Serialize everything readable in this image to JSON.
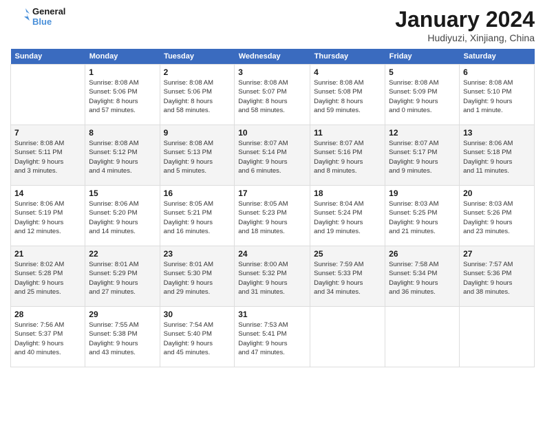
{
  "header": {
    "logo_general": "General",
    "logo_blue": "Blue",
    "month_title": "January 2024",
    "location": "Hudiyuzi, Xinjiang, China"
  },
  "days_of_week": [
    "Sunday",
    "Monday",
    "Tuesday",
    "Wednesday",
    "Thursday",
    "Friday",
    "Saturday"
  ],
  "weeks": [
    [
      {
        "num": "",
        "info": ""
      },
      {
        "num": "1",
        "info": "Sunrise: 8:08 AM\nSunset: 5:06 PM\nDaylight: 8 hours\nand 57 minutes."
      },
      {
        "num": "2",
        "info": "Sunrise: 8:08 AM\nSunset: 5:06 PM\nDaylight: 8 hours\nand 58 minutes."
      },
      {
        "num": "3",
        "info": "Sunrise: 8:08 AM\nSunset: 5:07 PM\nDaylight: 8 hours\nand 58 minutes."
      },
      {
        "num": "4",
        "info": "Sunrise: 8:08 AM\nSunset: 5:08 PM\nDaylight: 8 hours\nand 59 minutes."
      },
      {
        "num": "5",
        "info": "Sunrise: 8:08 AM\nSunset: 5:09 PM\nDaylight: 9 hours\nand 0 minutes."
      },
      {
        "num": "6",
        "info": "Sunrise: 8:08 AM\nSunset: 5:10 PM\nDaylight: 9 hours\nand 1 minute."
      }
    ],
    [
      {
        "num": "7",
        "info": "Sunrise: 8:08 AM\nSunset: 5:11 PM\nDaylight: 9 hours\nand 3 minutes."
      },
      {
        "num": "8",
        "info": "Sunrise: 8:08 AM\nSunset: 5:12 PM\nDaylight: 9 hours\nand 4 minutes."
      },
      {
        "num": "9",
        "info": "Sunrise: 8:08 AM\nSunset: 5:13 PM\nDaylight: 9 hours\nand 5 minutes."
      },
      {
        "num": "10",
        "info": "Sunrise: 8:07 AM\nSunset: 5:14 PM\nDaylight: 9 hours\nand 6 minutes."
      },
      {
        "num": "11",
        "info": "Sunrise: 8:07 AM\nSunset: 5:16 PM\nDaylight: 9 hours\nand 8 minutes."
      },
      {
        "num": "12",
        "info": "Sunrise: 8:07 AM\nSunset: 5:17 PM\nDaylight: 9 hours\nand 9 minutes."
      },
      {
        "num": "13",
        "info": "Sunrise: 8:06 AM\nSunset: 5:18 PM\nDaylight: 9 hours\nand 11 minutes."
      }
    ],
    [
      {
        "num": "14",
        "info": "Sunrise: 8:06 AM\nSunset: 5:19 PM\nDaylight: 9 hours\nand 12 minutes."
      },
      {
        "num": "15",
        "info": "Sunrise: 8:06 AM\nSunset: 5:20 PM\nDaylight: 9 hours\nand 14 minutes."
      },
      {
        "num": "16",
        "info": "Sunrise: 8:05 AM\nSunset: 5:21 PM\nDaylight: 9 hours\nand 16 minutes."
      },
      {
        "num": "17",
        "info": "Sunrise: 8:05 AM\nSunset: 5:23 PM\nDaylight: 9 hours\nand 18 minutes."
      },
      {
        "num": "18",
        "info": "Sunrise: 8:04 AM\nSunset: 5:24 PM\nDaylight: 9 hours\nand 19 minutes."
      },
      {
        "num": "19",
        "info": "Sunrise: 8:03 AM\nSunset: 5:25 PM\nDaylight: 9 hours\nand 21 minutes."
      },
      {
        "num": "20",
        "info": "Sunrise: 8:03 AM\nSunset: 5:26 PM\nDaylight: 9 hours\nand 23 minutes."
      }
    ],
    [
      {
        "num": "21",
        "info": "Sunrise: 8:02 AM\nSunset: 5:28 PM\nDaylight: 9 hours\nand 25 minutes."
      },
      {
        "num": "22",
        "info": "Sunrise: 8:01 AM\nSunset: 5:29 PM\nDaylight: 9 hours\nand 27 minutes."
      },
      {
        "num": "23",
        "info": "Sunrise: 8:01 AM\nSunset: 5:30 PM\nDaylight: 9 hours\nand 29 minutes."
      },
      {
        "num": "24",
        "info": "Sunrise: 8:00 AM\nSunset: 5:32 PM\nDaylight: 9 hours\nand 31 minutes."
      },
      {
        "num": "25",
        "info": "Sunrise: 7:59 AM\nSunset: 5:33 PM\nDaylight: 9 hours\nand 34 minutes."
      },
      {
        "num": "26",
        "info": "Sunrise: 7:58 AM\nSunset: 5:34 PM\nDaylight: 9 hours\nand 36 minutes."
      },
      {
        "num": "27",
        "info": "Sunrise: 7:57 AM\nSunset: 5:36 PM\nDaylight: 9 hours\nand 38 minutes."
      }
    ],
    [
      {
        "num": "28",
        "info": "Sunrise: 7:56 AM\nSunset: 5:37 PM\nDaylight: 9 hours\nand 40 minutes."
      },
      {
        "num": "29",
        "info": "Sunrise: 7:55 AM\nSunset: 5:38 PM\nDaylight: 9 hours\nand 43 minutes."
      },
      {
        "num": "30",
        "info": "Sunrise: 7:54 AM\nSunset: 5:40 PM\nDaylight: 9 hours\nand 45 minutes."
      },
      {
        "num": "31",
        "info": "Sunrise: 7:53 AM\nSunset: 5:41 PM\nDaylight: 9 hours\nand 47 minutes."
      },
      {
        "num": "",
        "info": ""
      },
      {
        "num": "",
        "info": ""
      },
      {
        "num": "",
        "info": ""
      }
    ]
  ]
}
